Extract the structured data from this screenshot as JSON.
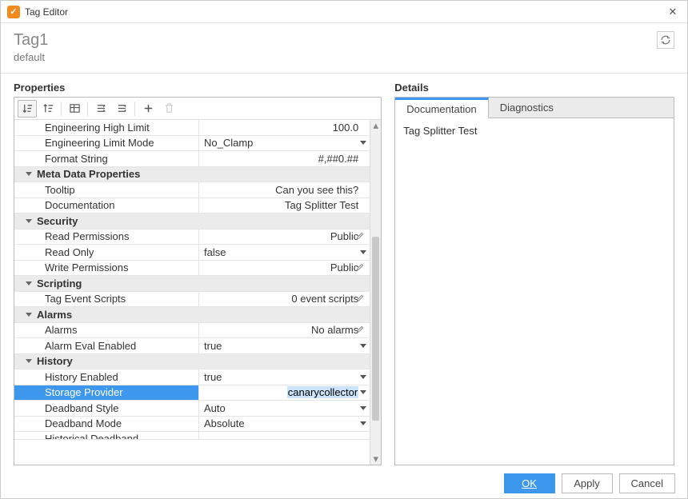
{
  "window": {
    "title": "Tag Editor"
  },
  "header": {
    "tag_name": "Tag1",
    "provider": "default"
  },
  "icons": {
    "app": "✓",
    "close": "✕",
    "refresh": "↻"
  },
  "toolbar_icons": {
    "sort_category": "sort-category",
    "sort_alpha": "sort-alpha",
    "view_table": "view-table",
    "adjust": "adjust",
    "expand_all": "expand-all",
    "add": "add",
    "delete": "delete"
  },
  "panels": {
    "properties_title": "Properties",
    "details_title": "Details"
  },
  "details": {
    "tabs": {
      "documentation": "Documentation",
      "diagnostics": "Diagnostics"
    },
    "active": "documentation",
    "content": "Tag Splitter Test"
  },
  "props": {
    "eng_high_limit": {
      "label": "Engineering High Limit",
      "value": "100.0"
    },
    "eng_limit_mode": {
      "label": "Engineering Limit Mode",
      "value": "No_Clamp"
    },
    "format_string": {
      "label": "Format String",
      "value": "#,##0.##"
    },
    "group_meta": {
      "label": "Meta Data Properties"
    },
    "tooltip": {
      "label": "Tooltip",
      "value": "Can you see this?"
    },
    "documentation": {
      "label": "Documentation",
      "value": "Tag Splitter Test"
    },
    "group_security": {
      "label": "Security"
    },
    "read_perm": {
      "label": "Read Permissions",
      "value": "Public"
    },
    "read_only": {
      "label": "Read Only",
      "value": "false"
    },
    "write_perm": {
      "label": "Write Permissions",
      "value": "Public"
    },
    "group_scripting": {
      "label": "Scripting"
    },
    "tag_events": {
      "label": "Tag Event Scripts",
      "value": "0 event scripts"
    },
    "group_alarms": {
      "label": "Alarms"
    },
    "alarms": {
      "label": "Alarms",
      "value": "No alarms"
    },
    "alarm_eval": {
      "label": "Alarm Eval Enabled",
      "value": "true"
    },
    "group_history": {
      "label": "History"
    },
    "history_enabled": {
      "label": "History Enabled",
      "value": "true"
    },
    "storage_provider": {
      "label": "Storage Provider",
      "value": "canarycollector"
    },
    "deadband_style": {
      "label": "Deadband Style",
      "value": "Auto"
    },
    "deadband_mode": {
      "label": "Deadband Mode",
      "value": "Absolute"
    },
    "hist_deadband": {
      "label": "Historical Deadband",
      "value": ""
    }
  },
  "buttons": {
    "ok": "OK",
    "apply": "Apply",
    "cancel": "Cancel"
  }
}
